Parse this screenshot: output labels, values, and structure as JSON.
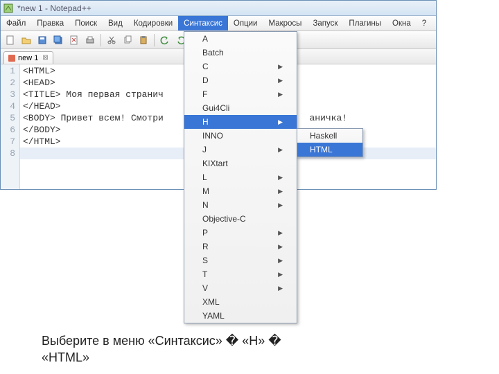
{
  "window": {
    "title": "*new  1 - Notepad++"
  },
  "menubar": {
    "items": [
      "Файл",
      "Правка",
      "Поиск",
      "Вид",
      "Кодировки",
      "Синтаксис",
      "Опции",
      "Макросы",
      "Запуск",
      "Плагины",
      "Окна",
      "?"
    ],
    "active_index": 5
  },
  "tab": {
    "label": "new 1"
  },
  "editor": {
    "lines": [
      "<HTML>",
      "<HEAD>",
      "<TITLE> Моя первая странич",
      "</HEAD>",
      "<BODY> Привет всем! Смотри                           аничка!",
      "</BODY>",
      "</HTML>",
      ""
    ]
  },
  "syntax_menu": [
    {
      "label": "A",
      "sub": false
    },
    {
      "label": "Batch",
      "sub": false
    },
    {
      "label": "C",
      "sub": true
    },
    {
      "label": "D",
      "sub": true
    },
    {
      "label": "F",
      "sub": true
    },
    {
      "label": "Gui4Cli",
      "sub": false
    },
    {
      "label": "H",
      "sub": true,
      "hl": true
    },
    {
      "label": "INNO",
      "sub": false
    },
    {
      "label": "J",
      "sub": true
    },
    {
      "label": "KIXtart",
      "sub": false
    },
    {
      "label": "L",
      "sub": true
    },
    {
      "label": "M",
      "sub": true
    },
    {
      "label": "N",
      "sub": true
    },
    {
      "label": "Objective-C",
      "sub": false
    },
    {
      "label": "P",
      "sub": true
    },
    {
      "label": "R",
      "sub": true
    },
    {
      "label": "S",
      "sub": true
    },
    {
      "label": "T",
      "sub": true
    },
    {
      "label": "V",
      "sub": true
    },
    {
      "label": "XML",
      "sub": false
    },
    {
      "label": "YAML",
      "sub": false
    }
  ],
  "sub_menu": [
    {
      "label": "Haskell",
      "hl": false
    },
    {
      "label": "HTML",
      "hl": true
    }
  ],
  "caption": {
    "line1": "Выберите в меню «Синтаксис» � «H» �",
    "line2": "«HTML»"
  }
}
